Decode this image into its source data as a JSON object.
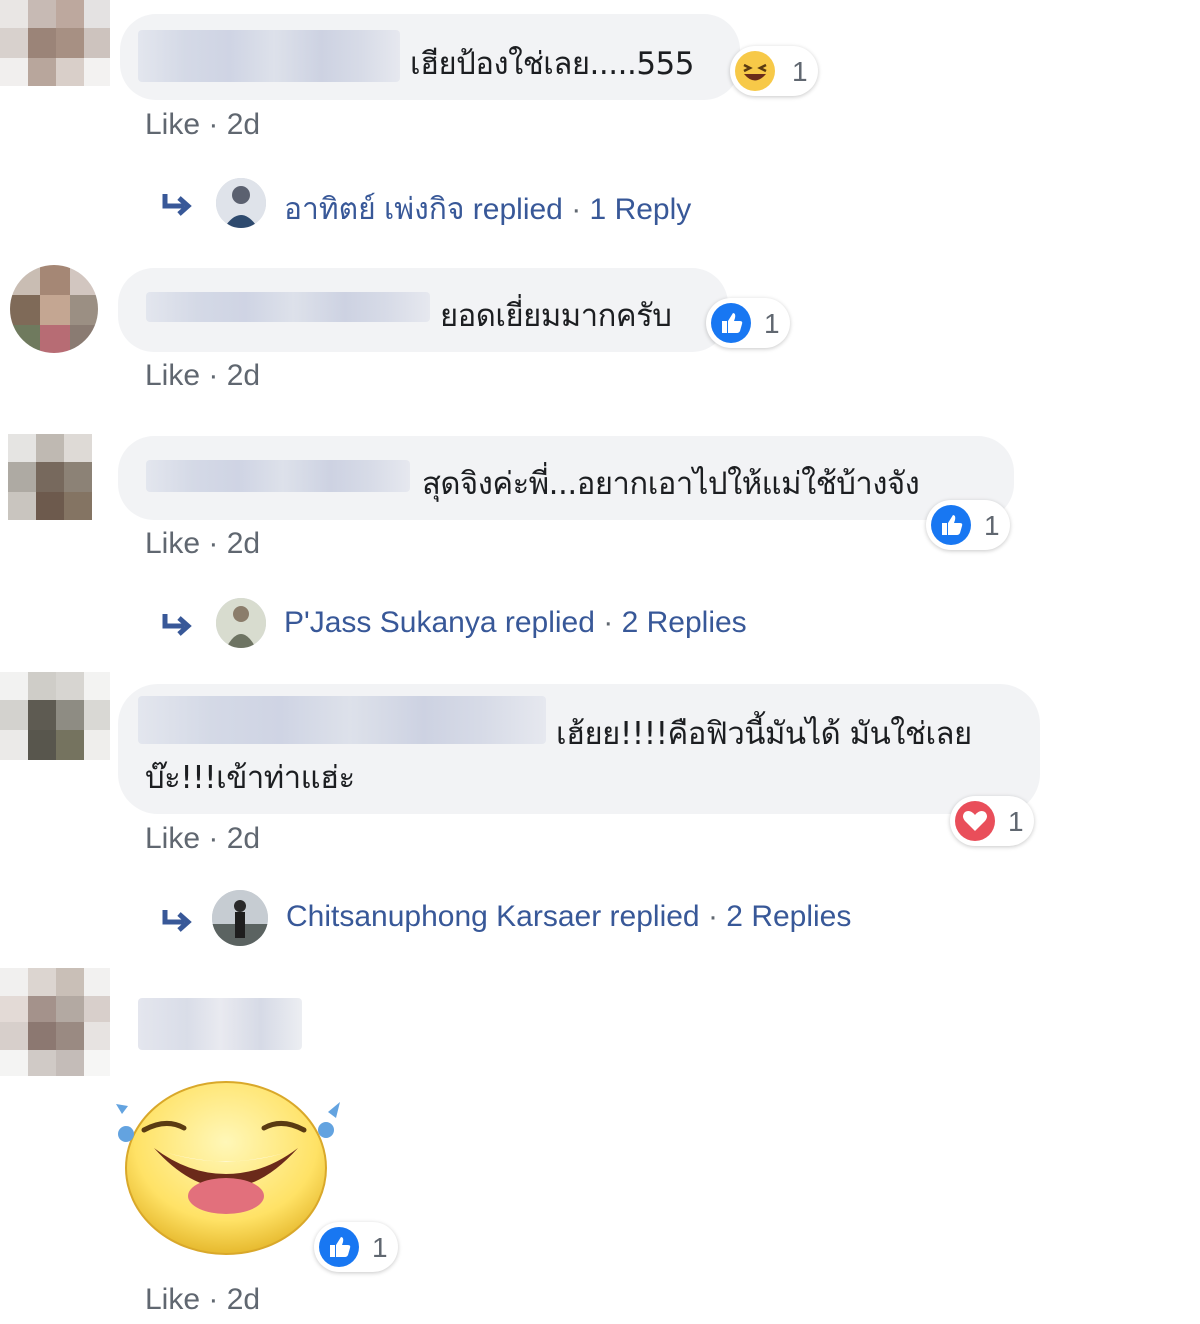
{
  "comments": [
    {
      "text": "เฮียป้องใช่เลย.....555",
      "meta_like": "Like",
      "meta_sep": " · ",
      "meta_time": "2d",
      "reaction": {
        "type": "haha",
        "count": "1"
      },
      "reply": {
        "name": "อาทิตย์ เพ่งกิจ",
        "verb": " replied",
        "sep": " · ",
        "count_label": "1 Reply"
      }
    },
    {
      "text": "ยอดเยี่ยมมากครับ",
      "meta_like": "Like",
      "meta_sep": " · ",
      "meta_time": "2d",
      "reaction": {
        "type": "like",
        "count": "1"
      }
    },
    {
      "text": "สุดจิงค่ะพี่...อยากเอาไปให้แม่ใช้บ้างจัง",
      "meta_like": "Like",
      "meta_sep": " · ",
      "meta_time": "2d",
      "reaction": {
        "type": "like",
        "count": "1"
      },
      "reply": {
        "name": "P'Jass Sukanya",
        "verb": " replied",
        "sep": " · ",
        "count_label": "2 Replies"
      }
    },
    {
      "text_line1": "เฮ้ยย!!!!คือฟิวนี้มันได้ มันใช่เลย",
      "text_line2": "บ๊ะ!!!เข้าท่าแฮ่ะ",
      "meta_like": "Like",
      "meta_sep": " · ",
      "meta_time": "2d",
      "reaction": {
        "type": "love",
        "count": "1"
      },
      "reply": {
        "name": "Chitsanuphong Karsaer",
        "verb": " replied",
        "sep": " · ",
        "count_label": "2 Replies"
      }
    },
    {
      "sticker": "laughing-sticker",
      "meta_like": "Like",
      "meta_sep": " · ",
      "meta_time": "2d",
      "reaction": {
        "type": "like",
        "count": "1"
      }
    }
  ],
  "colors": {
    "bubble": "#f2f3f5",
    "link": "#385898",
    "meta": "#606770",
    "like_blue": "#1877f2",
    "love_red": "#e94e5a",
    "haha_yellow": "#f7c948"
  }
}
